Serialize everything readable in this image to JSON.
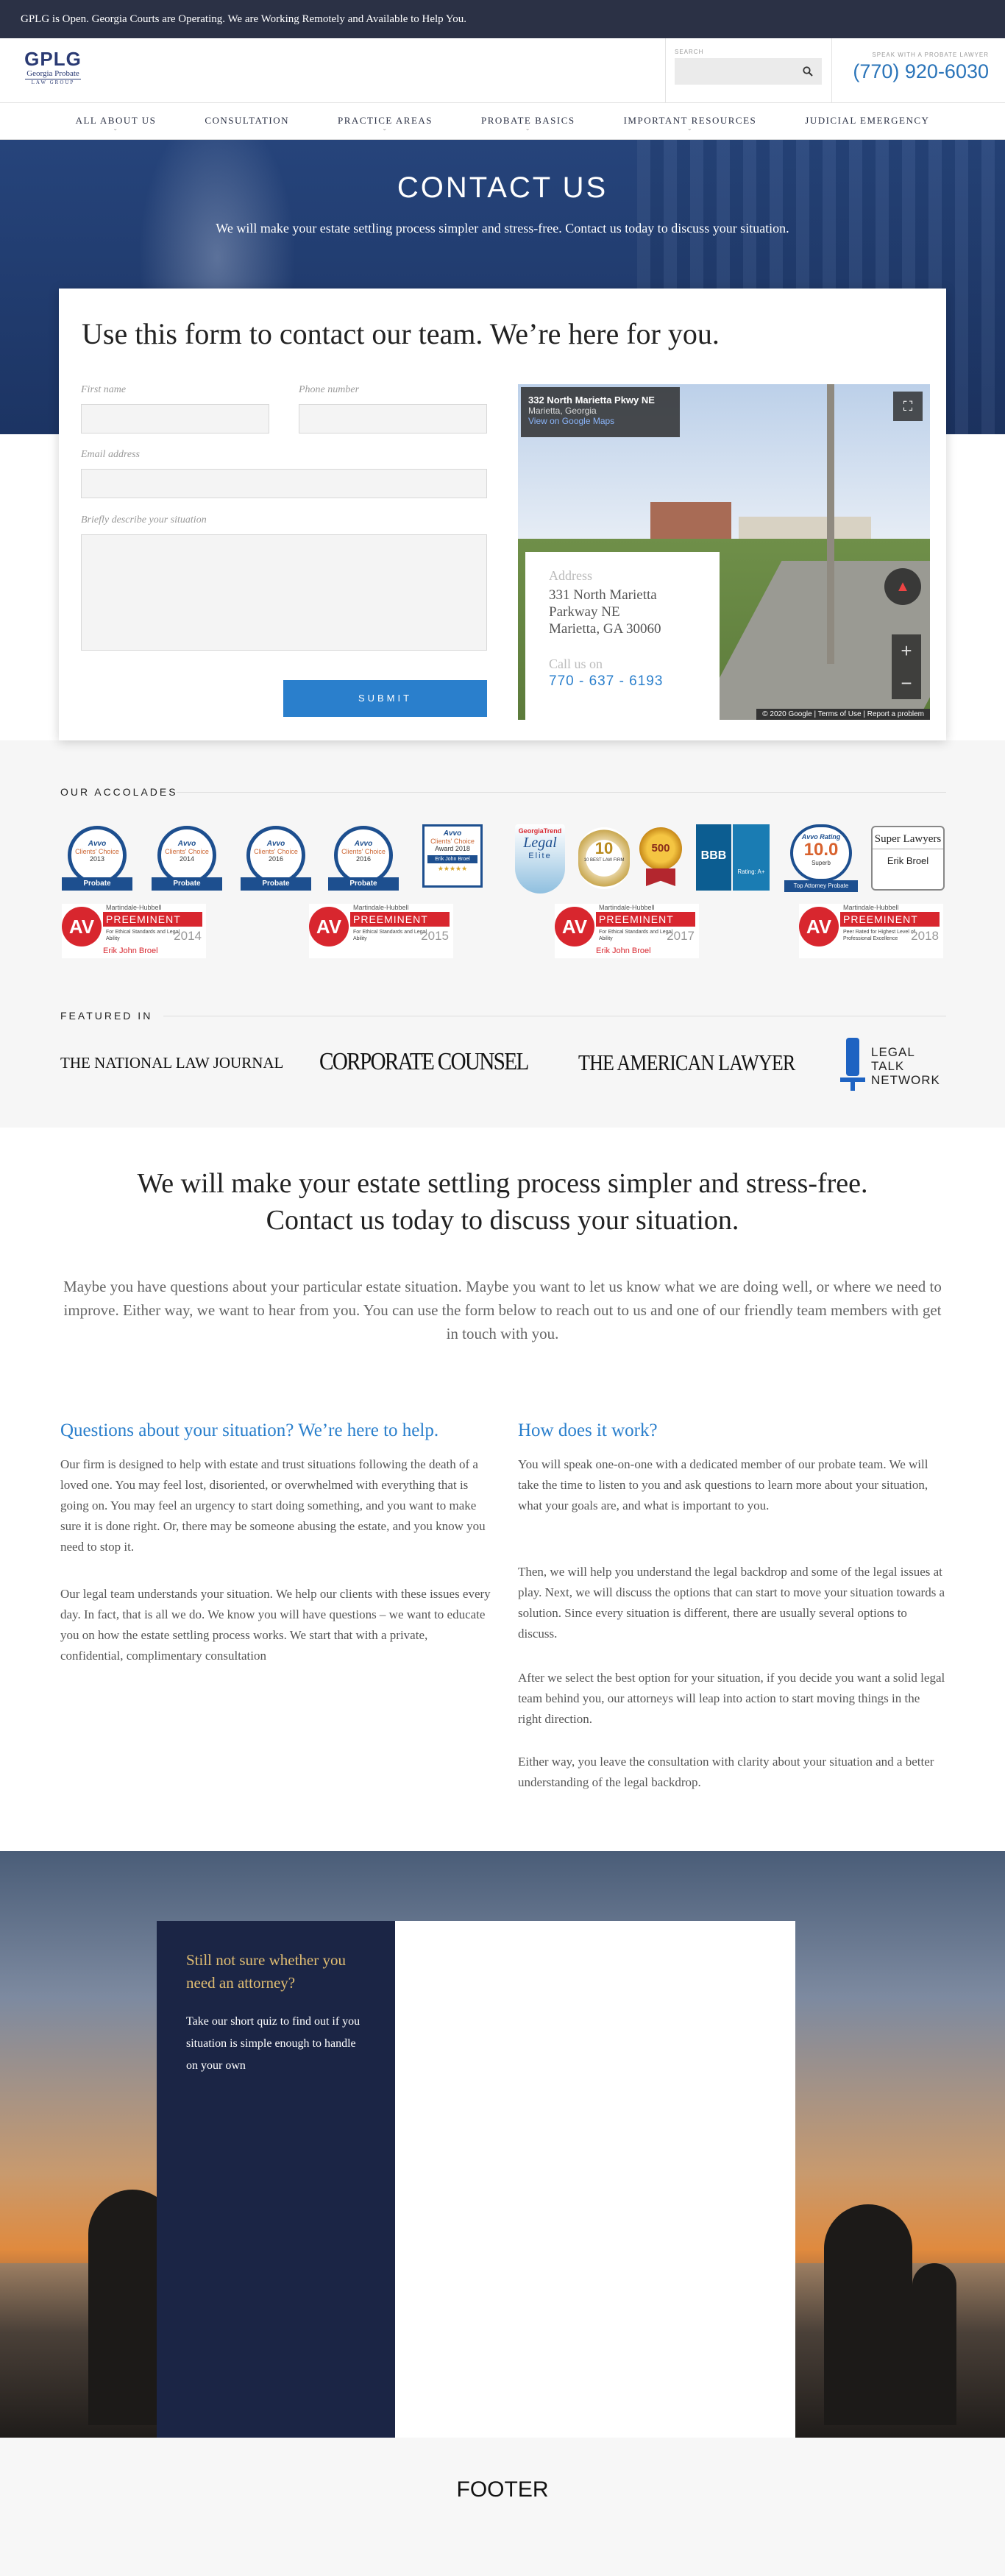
{
  "topbar": {
    "notice": "GPLG is Open. Georgia Courts are Operating. We are Working Remotely and Available to Help You."
  },
  "header": {
    "logo": {
      "mark": "GPLG",
      "name": "Georgia Probate",
      "sub": "LAW GROUP"
    },
    "search": {
      "label": "SEARCH",
      "placeholder": ""
    },
    "phone": {
      "label": "SPEAK WITH A PROBATE LAWYER",
      "number": "(770) 920-6030"
    }
  },
  "nav": {
    "items": [
      {
        "label": "ALL ABOUT US"
      },
      {
        "label": "CONSULTATION"
      },
      {
        "label": "PRACTICE AREAS"
      },
      {
        "label": "PROBATE BASICS"
      },
      {
        "label": "IMPORTANT RESOURCES"
      },
      {
        "label": "JUDICIAL EMERGENCY"
      }
    ]
  },
  "hero": {
    "title": "CONTACT US",
    "subtitle": "We will make your estate settling process simpler and stress-free. Contact us today to discuss your situation."
  },
  "form": {
    "heading": "Use this form to contact our team.  We’re here for you.",
    "first_name_label": "First name",
    "phone_label": "Phone number",
    "email_label": "Email address",
    "situation_label": "Briefly describe your situation",
    "submit_label": "SUBMIT"
  },
  "map": {
    "place_title": "332 North Marietta Pkwy NE",
    "place_sub": "Marietta, Georgia",
    "place_link": "View on Google Maps",
    "attribution": "© 2020 Google  |  Terms of Use  |  Report a problem",
    "address_label": "Address",
    "address_lines": [
      "331 North Marietta",
      "Parkway NE",
      "Marietta, GA 30060"
    ],
    "call_label": "Call us on",
    "call_number": "770 - 637 - 6193"
  },
  "accolades": {
    "title": "OUR ACCOLADES",
    "avvo": [
      {
        "brand": "Avvo",
        "label": "Clients' Choice",
        "year": "2013",
        "ribbon": "Probate"
      },
      {
        "brand": "Avvo",
        "label": "Clients' Choice",
        "year": "2014",
        "ribbon": "Probate"
      },
      {
        "brand": "Avvo",
        "label": "Clients' Choice",
        "year": "2016",
        "ribbon": "Probate"
      },
      {
        "brand": "Avvo",
        "label": "Clients' Choice",
        "year": "2016",
        "ribbon": "Probate"
      }
    ],
    "avvo_award": {
      "brand": "Avvo",
      "label": "Clients' Choice",
      "sub": "Award 2018",
      "name": "Erik John Broel"
    },
    "georgia_trend": {
      "top": "GeorgiaTrend",
      "mid": "Legal",
      "bot": "Elite"
    },
    "best_firms": {
      "num": "10",
      "label": "10 BEST LAW FIRM"
    },
    "top_badge": {
      "label": "500"
    },
    "bbb": {
      "label": "BBB",
      "rating": "Rating: A+"
    },
    "avvo_rating": {
      "brand": "Avvo Rating",
      "score": "10.0",
      "sub": "Superb",
      "ribbon": "Top Attorney Probate"
    },
    "superlawyers": {
      "title": "Super Lawyers",
      "name": "Erik Broel"
    },
    "av_badges": [
      {
        "av": "AV",
        "mh": "Martindale-Hubbell",
        "pre": "PREEMINENT",
        "sm": "For Ethical Standards and Legal Ability",
        "yr": "2014",
        "nm": "Erik John Broel"
      },
      {
        "av": "AV",
        "mh": "Martindale-Hubbell",
        "pre": "PREEMINENT",
        "sm": "For Ethical Standards and Legal Ability",
        "yr": "2015",
        "nm": ""
      },
      {
        "av": "AV",
        "mh": "Martindale-Hubbell",
        "pre": "PREEMINENT",
        "sm": "For Ethical Standards and Legal Ability",
        "yr": "2017",
        "nm": "Erik John Broel"
      },
      {
        "av": "AV",
        "mh": "Martindale-Hubbell",
        "pre": "PREEMINENT",
        "sm": "Peer Rated for Highest Level of Professional Excellence",
        "yr": "2018",
        "nm": ""
      }
    ]
  },
  "featured": {
    "title": "FEATURED IN",
    "outlets": [
      {
        "name": "THE NATIONAL LAW JOURNAL"
      },
      {
        "name": "CORPORATE COUNSEL"
      },
      {
        "name": "THE AMERICAN LAWYER"
      },
      {
        "name": "LEGAL TALK NETWORK"
      }
    ]
  },
  "intro": {
    "heading_line1": "We will make your estate settling process simpler and stress-free.",
    "heading_line2": "Contact us today to discuss your situation.",
    "body": "Maybe you have questions about your particular estate situation. Maybe you want to let us know what we are doing well, or where we need to improve. Either way, we want to hear from you. You can use the form below to reach out to us and one of our friendly team members with get in touch with you."
  },
  "columns": {
    "left": {
      "heading": "Questions about your situation? We’re here to help.",
      "p1": "Our firm is designed to help with estate and trust situations following the death of a loved one. You may feel lost, disoriented, or overwhelmed with everything that is going on. You may feel an urgency to start doing something, and you want to make sure it is done right. Or, there may be someone abusing the estate, and you know you need to stop it.",
      "p2": "Our legal team understands your situation. We help our clients with these issues every day. In fact, that is all we do. We know you will have questions – we want to educate you on how the estate settling process works. We start that with a private, confidential, complimentary consultation"
    },
    "right": {
      "heading": "How does it work?",
      "p1": "You will speak one-on-one with a dedicated member of our probate team. We will take the time to listen to you and ask questions to learn more about your situation, what your goals are, and what is important to you.",
      "p2": "Then, we will help you understand the legal backdrop and some of the legal issues at play. Next, we will discuss the options that can start to move your situation towards a solution. Since every situation is different, there are usually several options to discuss.",
      "p3": "After we select the best option for your situation, if you decide you want a solid legal team behind you, our attorneys will leap into action to start moving things in the right direction.",
      "p4": "Either way, you leave the consultation with clarity about your situation and a better understanding of the legal backdrop."
    }
  },
  "quiz": {
    "heading": "Still not sure whether you need an attorney?",
    "body": "Take our short quiz to find out if you situation is simple enough to handle on your own"
  },
  "footer": {
    "label": "FOOTER"
  }
}
